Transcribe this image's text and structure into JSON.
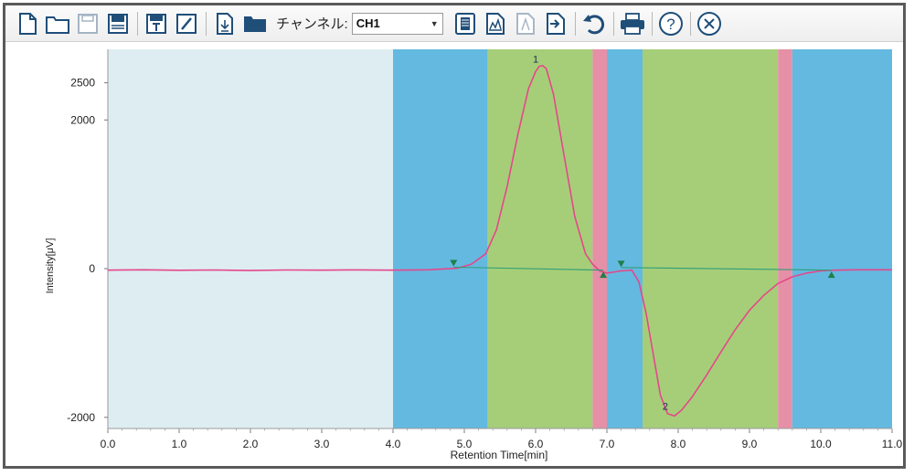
{
  "toolbar": {
    "channel_label": "チャンネル:",
    "channel_value": "CH1",
    "icons": [
      "new-file-icon",
      "open-folder-icon",
      "save-disabled-icon",
      "save-icon",
      "save-template-icon",
      "edit-icon",
      "import-icon",
      "folder-icon",
      "report-icon",
      "peak-analysis-icon",
      "calibration-disabled-icon",
      "export-icon",
      "undo-icon",
      "print-icon",
      "help-icon",
      "close-icon"
    ]
  },
  "chart_data": {
    "type": "line",
    "xlabel": "Retention Time[min]",
    "ylabel": "Intensity[μV]",
    "xlim": [
      0.0,
      11.0
    ],
    "ylim": [
      -2150,
      2950
    ],
    "x_ticks": [
      "0.0",
      "1.0",
      "2.0",
      "3.0",
      "4.0",
      "5.0",
      "6.0",
      "7.0",
      "8.0",
      "9.0",
      "10.0",
      "11.0"
    ],
    "y_ticks": [
      2500,
      2000,
      0,
      -2000
    ],
    "y_tick_labels": [
      "2500",
      "2000",
      "0",
      "-2000"
    ],
    "regions": [
      {
        "kind": "baseline",
        "from": 0.0,
        "to": 4.0,
        "color": "#deedf2"
      },
      {
        "kind": "noise",
        "from": 4.0,
        "to": 5.33,
        "color": "#64b9e0"
      },
      {
        "kind": "peak",
        "from": 5.33,
        "to": 6.8,
        "color": "#a6ce78"
      },
      {
        "kind": "boundary",
        "from": 6.8,
        "to": 7.0,
        "color": "#e590a6"
      },
      {
        "kind": "noise",
        "from": 7.0,
        "to": 7.5,
        "color": "#64b9e0"
      },
      {
        "kind": "peak",
        "from": 7.5,
        "to": 9.4,
        "color": "#a6ce78"
      },
      {
        "kind": "boundary",
        "from": 9.4,
        "to": 9.6,
        "color": "#e590a6"
      },
      {
        "kind": "noise",
        "from": 9.6,
        "to": 11.0,
        "color": "#64b9e0"
      }
    ],
    "series": [
      {
        "color": "#e5478b",
        "x": [
          0.0,
          0.5,
          1.0,
          1.5,
          2.0,
          2.5,
          3.0,
          3.5,
          4.0,
          4.5,
          4.9,
          5.1,
          5.3,
          5.45,
          5.6,
          5.75,
          5.9,
          6.0,
          6.05,
          6.1,
          6.15,
          6.25,
          6.4,
          6.55,
          6.7,
          6.8,
          6.9,
          7.0,
          7.2,
          7.35,
          7.45,
          7.55,
          7.65,
          7.75,
          7.85,
          7.95,
          8.05,
          8.2,
          8.4,
          8.6,
          8.8,
          9.0,
          9.2,
          9.4,
          9.6,
          9.8,
          10.0,
          10.2,
          10.5,
          11.0
        ],
        "y": [
          -20,
          -15,
          -22,
          -18,
          -25,
          -18,
          -20,
          -17,
          -20,
          -15,
          5,
          60,
          200,
          520,
          1100,
          1800,
          2420,
          2650,
          2720,
          2730,
          2690,
          2350,
          1520,
          700,
          200,
          60,
          -30,
          -60,
          -30,
          -20,
          -180,
          -600,
          -1150,
          -1700,
          -1950,
          -1980,
          -1900,
          -1720,
          -1430,
          -1120,
          -820,
          -560,
          -360,
          -200,
          -110,
          -60,
          -30,
          -20,
          -15,
          -15
        ]
      },
      {
        "color": "#2f9e77",
        "x": [
          4.85,
          6.95
        ],
        "y": [
          20,
          -20
        ]
      },
      {
        "color": "#2f9e77",
        "x": [
          7.2,
          10.15
        ],
        "y": [
          15,
          -20
        ]
      }
    ],
    "peak_labels": [
      {
        "label": "1",
        "x": 6.0,
        "y": 2770
      },
      {
        "label": "2",
        "x": 7.82,
        "y": -1900
      }
    ],
    "markers": [
      {
        "x": 4.85,
        "y": 80,
        "dir": "down"
      },
      {
        "x": 6.95,
        "y": -75,
        "dir": "up"
      },
      {
        "x": 7.2,
        "y": 70,
        "dir": "down"
      },
      {
        "x": 10.15,
        "y": -75,
        "dir": "up"
      }
    ]
  }
}
